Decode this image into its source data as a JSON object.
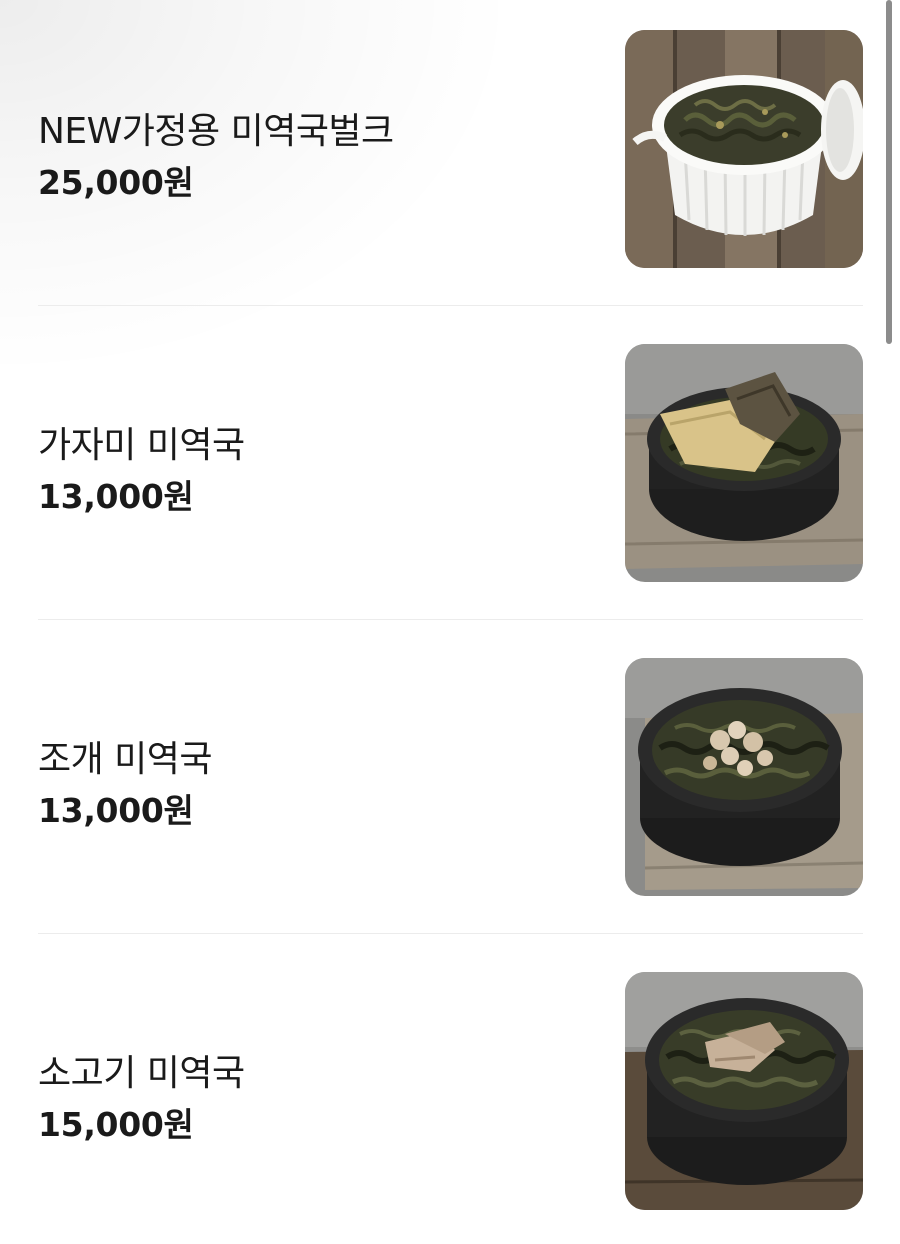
{
  "menu": {
    "items": [
      {
        "name": "NEW가정용 미역국벌크",
        "price": "25,000원",
        "image": "seaweed-soup-bulk-container-photo"
      },
      {
        "name": "가자미 미역국",
        "price": "13,000원",
        "image": "flounder-seaweed-soup-photo"
      },
      {
        "name": "조개 미역국",
        "price": "13,000원",
        "image": "clam-seaweed-soup-photo"
      },
      {
        "name": "소고기 미역국",
        "price": "15,000원",
        "image": "beef-seaweed-soup-photo"
      }
    ]
  },
  "colors": {
    "text": "#1a1a1a",
    "divider": "#ececec",
    "scrollbar": "#8c8c8c"
  }
}
